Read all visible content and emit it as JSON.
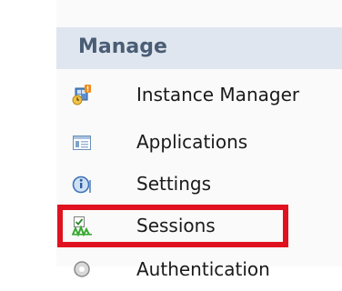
{
  "section": {
    "title": "Manage"
  },
  "menu": {
    "items": [
      {
        "label": "Instance Manager",
        "icon": "instance-manager-icon"
      },
      {
        "label": "Applications",
        "icon": "applications-icon"
      },
      {
        "label": "Settings",
        "icon": "settings-info-icon"
      },
      {
        "label": "Sessions",
        "icon": "sessions-icon"
      },
      {
        "label": "Authentication",
        "icon": "authentication-icon"
      }
    ]
  },
  "colors": {
    "header_bg": "#dfe6ef",
    "header_text": "#4a5d75",
    "highlight": "#e0121f"
  }
}
